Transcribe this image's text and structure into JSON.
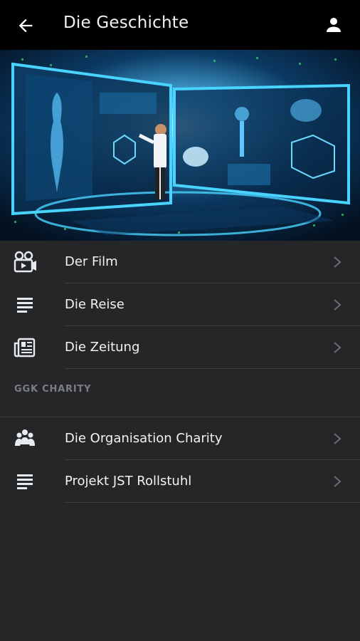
{
  "header": {
    "title": "Die Geschichte",
    "back_icon": "arrow-left-icon",
    "user_icon": "person-icon"
  },
  "hero": {
    "description_icon": "hero-image"
  },
  "menu": {
    "items": [
      {
        "label": "Der Film",
        "icon": "video-camera-icon"
      },
      {
        "label": "Die Reise",
        "icon": "text-lines-icon"
      },
      {
        "label": "Die Zeitung",
        "icon": "newspaper-icon"
      }
    ]
  },
  "charity": {
    "section_title": "GGK CHARITY",
    "items": [
      {
        "label": "Die Organisation Charity",
        "icon": "group-icon"
      },
      {
        "label": "Projekt JST Rollstuhl",
        "icon": "text-lines-icon"
      }
    ]
  },
  "colors": {
    "appbar_bg": "#000000",
    "page_bg": "#252628",
    "divider": "#3d3f43",
    "section_title": "#7a7d82",
    "hero_glow": "#3fc8ff"
  }
}
